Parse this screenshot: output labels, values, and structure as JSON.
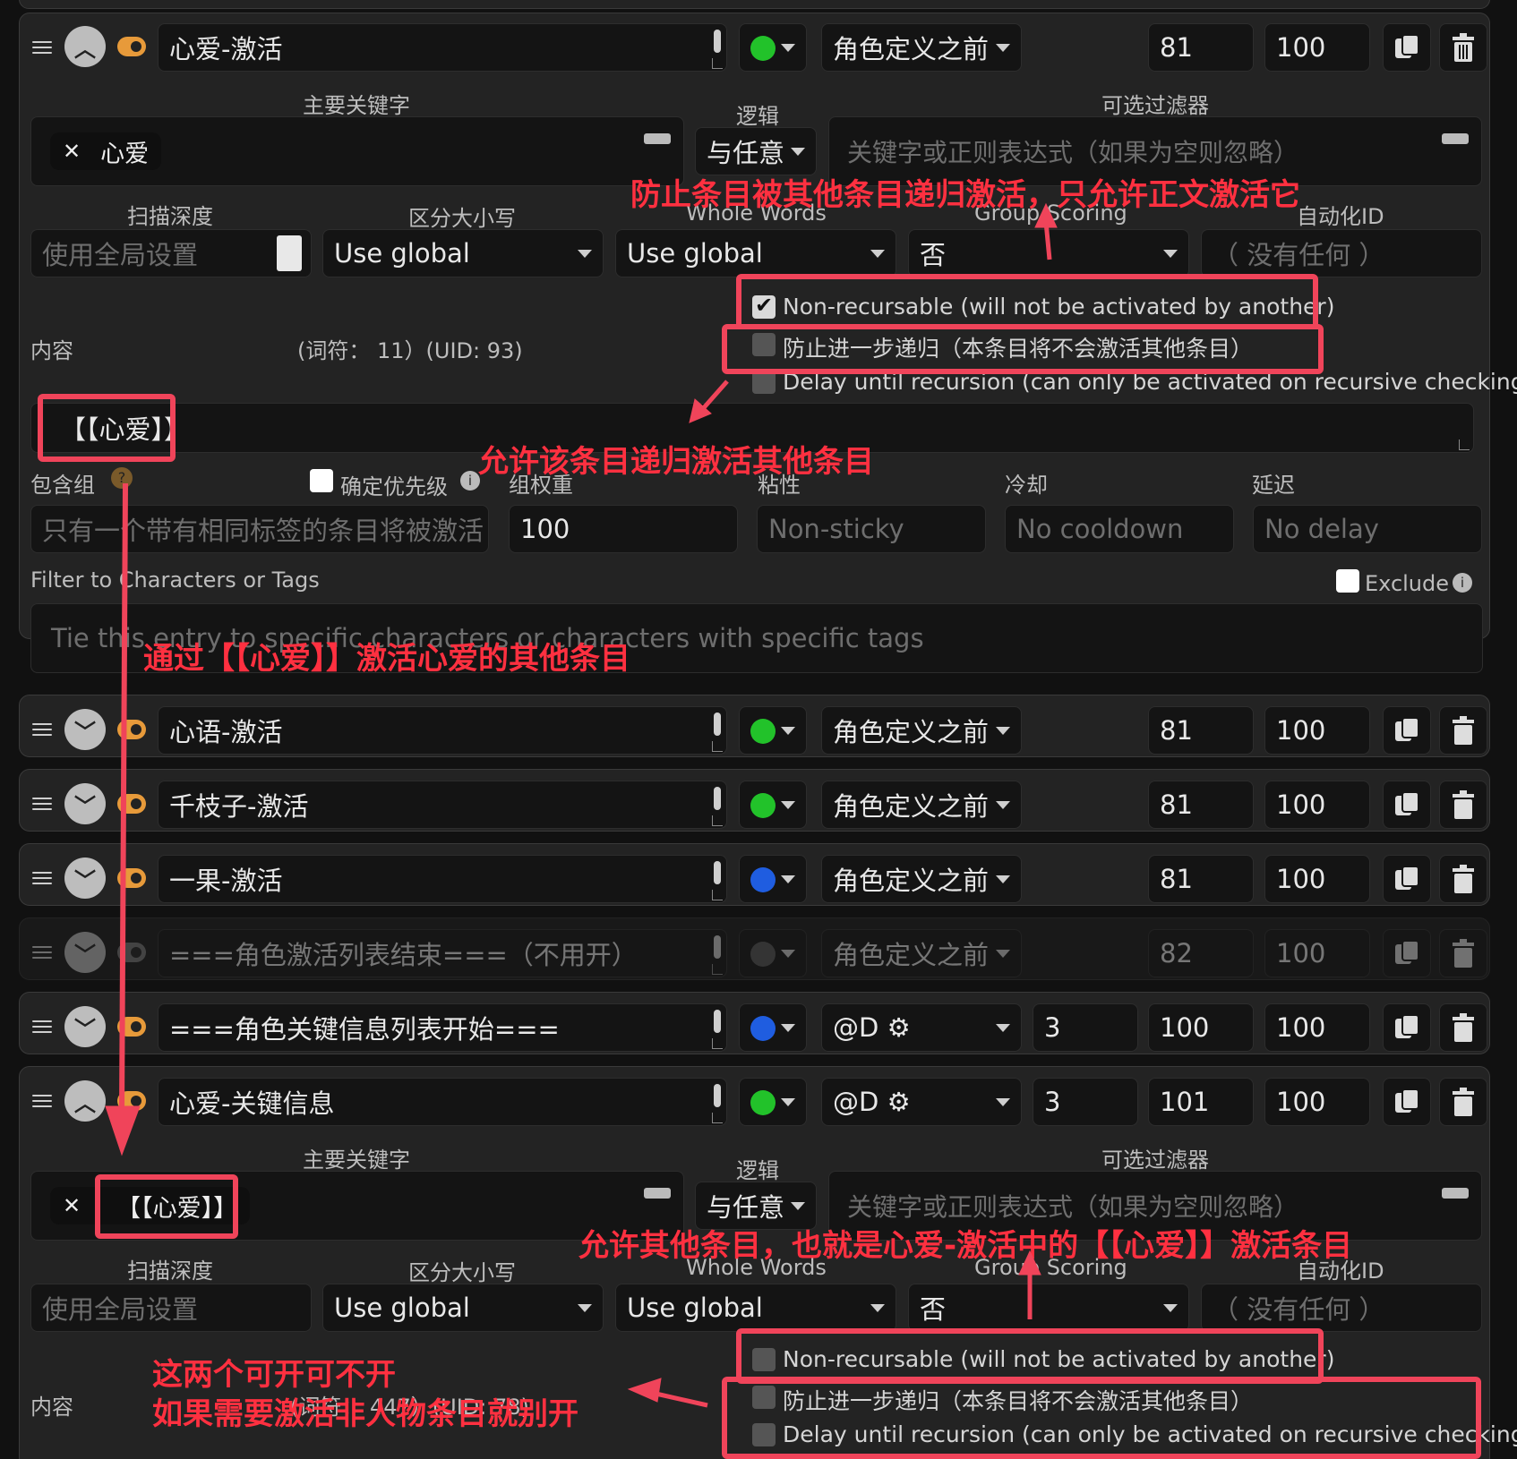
{
  "entries": {
    "e1": {
      "title": "心爱-激活",
      "position": "角色定义之前",
      "order": "81",
      "prob": "100",
      "status_color": "#22c22a"
    },
    "e2": {
      "title": "心语-激活",
      "position": "角色定义之前",
      "order": "81",
      "prob": "100",
      "status_color": "#22c22a"
    },
    "e3": {
      "title": "千枝子-激活",
      "position": "角色定义之前",
      "order": "81",
      "prob": "100",
      "status_color": "#22c22a"
    },
    "e4": {
      "title": "一果-激活",
      "position": "角色定义之前",
      "order": "81",
      "prob": "100",
      "status_color": "#1f5de0"
    },
    "e5": {
      "title": "===角色激活列表结束===（不用开）",
      "position": "角色定义之前",
      "order": "82",
      "prob": "100",
      "status_color": "#555555"
    },
    "e6": {
      "title": "===角色关键信息列表开始===",
      "position": "@D ⚙",
      "depth": "3",
      "order": "100",
      "prob": "100",
      "status_color": "#1f5de0"
    },
    "e7": {
      "title": "心爱-关键信息",
      "position": "@D ⚙",
      "depth": "3",
      "order": "101",
      "prob": "100",
      "status_color": "#22c22a"
    }
  },
  "labels": {
    "primary_keywords": "主要关键字",
    "logic": "逻辑",
    "optional_filter": "可选过滤器",
    "scan_depth": "扫描深度",
    "case_sensitive": "区分大小写",
    "whole_words": "Whole Words",
    "group_scoring": "Group Scoring",
    "automation_id": "自动化ID",
    "content": "内容",
    "inclusion_group": "包含组",
    "prioritize": "确定优先级",
    "group_weight": "组权重",
    "sticky": "粘性",
    "cooldown": "冷却",
    "delay": "延迟",
    "filter_chars": "Filter to Characters or Tags",
    "exclude": "Exclude"
  },
  "block1": {
    "key_tag": "心爱",
    "logic_value": "与任意",
    "filter_placeholder": "关键字或正则表达式（如果为空则忽略）",
    "scan_placeholder": "使用全局设置",
    "case_value": "Use global",
    "whole_value": "Use global",
    "group_scoring_value": "否",
    "automation_placeholder": "（ 没有任何 ）",
    "content_meta": "(词符：   11）(UID: 93)",
    "content_text": "【【心爱】】",
    "inclusion_placeholder": "只有一个带有相同标签的条目将被激活",
    "group_weight_value": "100",
    "sticky_placeholder": "Non-sticky",
    "cooldown_placeholder": "No cooldown",
    "delay_placeholder": "No delay",
    "filter_chars_placeholder": "Tie this entry to specific characters or characters with specific tags",
    "non_recursable": "Non-recursable (will not be activated by another)",
    "prevent_recursion": "防止进一步递归（本条目将不会激活其他条目）",
    "delay_recursion": "Delay until recursion (can only be activated on recursive checking)"
  },
  "block2": {
    "key_tag": "【【心爱】】",
    "logic_value": "与任意",
    "filter_placeholder": "关键字或正则表达式（如果为空则忽略）",
    "scan_placeholder": "使用全局设置",
    "case_value": "Use global",
    "whole_value": "Use global",
    "group_scoring_value": "否",
    "automation_placeholder": "（ 没有任何 ）",
    "content_meta": "(词符：   447）(UID: 78)",
    "non_recursable": "Non-recursable (will not be activated by another)",
    "prevent_recursion": "防止进一步递归（本条目将不会激活其他条目）",
    "delay_recursion": "Delay until recursion (can only be activated on recursive checking)"
  },
  "annotations": {
    "a1": "防止条目被其他条目递归激活，只允许正文激活它",
    "a2": "允许该条目递归激活其他条目",
    "a3": "通过【【心爱】】激活心爱的其他条目",
    "a4": "允许其他条目，也就是心爱-激活中的【【心爱】】激活条目",
    "a5_line1": "这两个可开可不开",
    "a5_line2": "如果需要激活非人物条目就别开"
  },
  "colors": {
    "annotation": "#f0445a",
    "toggle": "#e79a3a"
  }
}
